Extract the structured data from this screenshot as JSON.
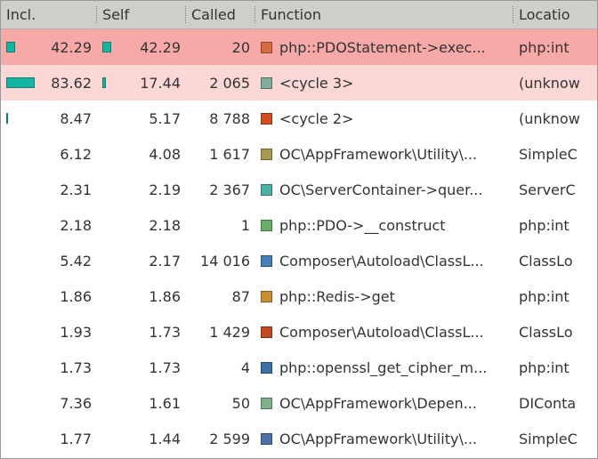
{
  "columns": {
    "incl": "Incl.",
    "self": "Self",
    "called": "Called",
    "func": "Function",
    "loc": "Locatio"
  },
  "rows": [
    {
      "incl": "42.29",
      "self": "42.29",
      "called": "20",
      "incl_bar": 10,
      "self_bar": 10,
      "sq": "#d66c3f",
      "func": "php::PDOStatement->exec...",
      "loc": "php:int",
      "hl": "dark"
    },
    {
      "incl": "83.62",
      "self": "17.44",
      "called": "2 065",
      "incl_bar": 32,
      "self_bar": 4,
      "sq": "#7cad9f",
      "func": "<cycle 3>",
      "loc": "(unknow",
      "hl": "light"
    },
    {
      "incl": "8.47",
      "self": "5.17",
      "called": "8 788",
      "incl_bar": 2,
      "self_bar": 0,
      "sq": "#d24f1d",
      "func": "<cycle 2>",
      "loc": "(unknow",
      "hl": ""
    },
    {
      "incl": "6.12",
      "self": "4.08",
      "called": "1 617",
      "incl_bar": 0,
      "self_bar": 0,
      "sq": "#a89a4f",
      "func": "OC\\AppFramework\\Utility\\...",
      "loc": "SimpleC",
      "hl": ""
    },
    {
      "incl": "2.31",
      "self": "2.19",
      "called": "2 367",
      "incl_bar": 0,
      "self_bar": 0,
      "sq": "#4bb3a6",
      "func": "OC\\ServerContainer->quer...",
      "loc": "ServerC",
      "hl": ""
    },
    {
      "incl": "2.18",
      "self": "2.18",
      "called": "1",
      "incl_bar": 0,
      "self_bar": 0,
      "sq": "#68b06a",
      "func": "php::PDO->__construct",
      "loc": "php:int",
      "hl": ""
    },
    {
      "incl": "5.42",
      "self": "2.17",
      "called": "14 016",
      "incl_bar": 0,
      "self_bar": 0,
      "sq": "#4580b8",
      "func": "Composer\\Autoload\\ClassL...",
      "loc": "ClassLo",
      "hl": ""
    },
    {
      "incl": "1.86",
      "self": "1.86",
      "called": "87",
      "incl_bar": 0,
      "self_bar": 0,
      "sq": "#c98f2d",
      "func": "php::Redis->get",
      "loc": "php:int",
      "hl": ""
    },
    {
      "incl": "1.93",
      "self": "1.73",
      "called": "1 429",
      "incl_bar": 0,
      "self_bar": 0,
      "sq": "#c24a1e",
      "func": "Composer\\Autoload\\ClassL...",
      "loc": "ClassLo",
      "hl": ""
    },
    {
      "incl": "1.73",
      "self": "1.73",
      "called": "4",
      "incl_bar": 0,
      "self_bar": 0,
      "sq": "#3a6fa8",
      "func": "php::openssl_get_cipher_m...",
      "loc": "php:int",
      "hl": ""
    },
    {
      "incl": "7.36",
      "self": "1.61",
      "called": "50",
      "incl_bar": 0,
      "self_bar": 0,
      "sq": "#7fb18b",
      "func": "OC\\AppFramework\\Depen...",
      "loc": "DIConta",
      "hl": ""
    },
    {
      "incl": "1.77",
      "self": "1.44",
      "called": "2 599",
      "incl_bar": 0,
      "self_bar": 0,
      "sq": "#4e6fa8",
      "func": "OC\\AppFramework\\Utility\\...",
      "loc": "SimpleC",
      "hl": ""
    }
  ]
}
